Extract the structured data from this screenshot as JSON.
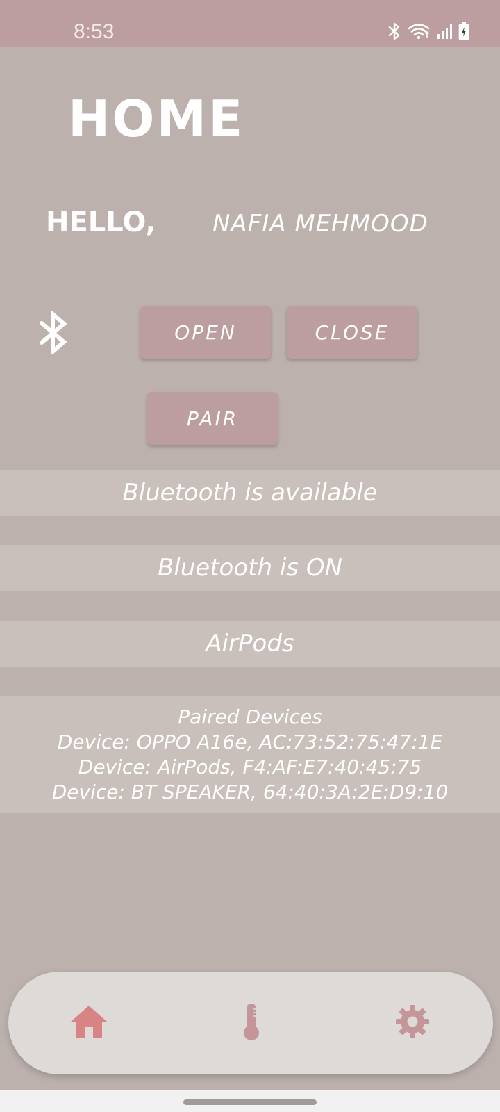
{
  "status_bar": {
    "time": "8:53",
    "icons": [
      "bluetooth-icon",
      "wifi-icon",
      "signal-icon",
      "battery-charging-icon"
    ]
  },
  "page": {
    "title": "HOME",
    "greeting": "HELLO,",
    "user_name": "NAFIA MEHMOOD"
  },
  "bluetooth": {
    "icon": "bluetooth-icon",
    "buttons": {
      "open": "OPEN",
      "close": "CLOSE",
      "pair": "PAIR"
    },
    "availability_status": "Bluetooth is available",
    "power_status": "Bluetooth is ON",
    "connected_device": "AirPods",
    "paired_devices": {
      "heading": "Paired Devices",
      "items": [
        "Device: OPPO A16e, AC:73:52:75:47:1E",
        "Device: AirPods, F4:AF:E7:40:45:75",
        "Device: BT SPEAKER, 64:40:3A:2E:D9:10"
      ]
    }
  },
  "bottom_nav": {
    "items": [
      {
        "icon": "home-icon",
        "active": true
      },
      {
        "icon": "thermometer-icon",
        "active": false
      },
      {
        "icon": "gear-icon",
        "active": false
      }
    ]
  },
  "colors": {
    "background": "#bdb1ae",
    "status_bar": "#bd9ea0",
    "button": "#bd9ea0",
    "info_strip": "#c9bfbb",
    "nav_bar": "#dddad8",
    "nav_active": "#d98484",
    "nav_inactive": "#c4969a"
  }
}
